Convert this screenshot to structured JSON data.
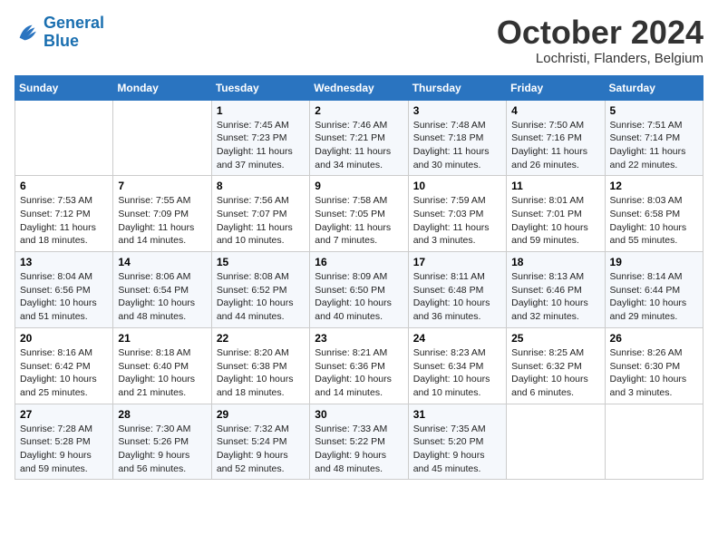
{
  "logo": {
    "line1": "General",
    "line2": "Blue"
  },
  "title": "October 2024",
  "location": "Lochristi, Flanders, Belgium",
  "days_of_week": [
    "Sunday",
    "Monday",
    "Tuesday",
    "Wednesday",
    "Thursday",
    "Friday",
    "Saturday"
  ],
  "weeks": [
    [
      {
        "day": "",
        "content": ""
      },
      {
        "day": "",
        "content": ""
      },
      {
        "day": "1",
        "content": "Sunrise: 7:45 AM\nSunset: 7:23 PM\nDaylight: 11 hours\nand 37 minutes."
      },
      {
        "day": "2",
        "content": "Sunrise: 7:46 AM\nSunset: 7:21 PM\nDaylight: 11 hours\nand 34 minutes."
      },
      {
        "day": "3",
        "content": "Sunrise: 7:48 AM\nSunset: 7:18 PM\nDaylight: 11 hours\nand 30 minutes."
      },
      {
        "day": "4",
        "content": "Sunrise: 7:50 AM\nSunset: 7:16 PM\nDaylight: 11 hours\nand 26 minutes."
      },
      {
        "day": "5",
        "content": "Sunrise: 7:51 AM\nSunset: 7:14 PM\nDaylight: 11 hours\nand 22 minutes."
      }
    ],
    [
      {
        "day": "6",
        "content": "Sunrise: 7:53 AM\nSunset: 7:12 PM\nDaylight: 11 hours\nand 18 minutes."
      },
      {
        "day": "7",
        "content": "Sunrise: 7:55 AM\nSunset: 7:09 PM\nDaylight: 11 hours\nand 14 minutes."
      },
      {
        "day": "8",
        "content": "Sunrise: 7:56 AM\nSunset: 7:07 PM\nDaylight: 11 hours\nand 10 minutes."
      },
      {
        "day": "9",
        "content": "Sunrise: 7:58 AM\nSunset: 7:05 PM\nDaylight: 11 hours\nand 7 minutes."
      },
      {
        "day": "10",
        "content": "Sunrise: 7:59 AM\nSunset: 7:03 PM\nDaylight: 11 hours\nand 3 minutes."
      },
      {
        "day": "11",
        "content": "Sunrise: 8:01 AM\nSunset: 7:01 PM\nDaylight: 10 hours\nand 59 minutes."
      },
      {
        "day": "12",
        "content": "Sunrise: 8:03 AM\nSunset: 6:58 PM\nDaylight: 10 hours\nand 55 minutes."
      }
    ],
    [
      {
        "day": "13",
        "content": "Sunrise: 8:04 AM\nSunset: 6:56 PM\nDaylight: 10 hours\nand 51 minutes."
      },
      {
        "day": "14",
        "content": "Sunrise: 8:06 AM\nSunset: 6:54 PM\nDaylight: 10 hours\nand 48 minutes."
      },
      {
        "day": "15",
        "content": "Sunrise: 8:08 AM\nSunset: 6:52 PM\nDaylight: 10 hours\nand 44 minutes."
      },
      {
        "day": "16",
        "content": "Sunrise: 8:09 AM\nSunset: 6:50 PM\nDaylight: 10 hours\nand 40 minutes."
      },
      {
        "day": "17",
        "content": "Sunrise: 8:11 AM\nSunset: 6:48 PM\nDaylight: 10 hours\nand 36 minutes."
      },
      {
        "day": "18",
        "content": "Sunrise: 8:13 AM\nSunset: 6:46 PM\nDaylight: 10 hours\nand 32 minutes."
      },
      {
        "day": "19",
        "content": "Sunrise: 8:14 AM\nSunset: 6:44 PM\nDaylight: 10 hours\nand 29 minutes."
      }
    ],
    [
      {
        "day": "20",
        "content": "Sunrise: 8:16 AM\nSunset: 6:42 PM\nDaylight: 10 hours\nand 25 minutes."
      },
      {
        "day": "21",
        "content": "Sunrise: 8:18 AM\nSunset: 6:40 PM\nDaylight: 10 hours\nand 21 minutes."
      },
      {
        "day": "22",
        "content": "Sunrise: 8:20 AM\nSunset: 6:38 PM\nDaylight: 10 hours\nand 18 minutes."
      },
      {
        "day": "23",
        "content": "Sunrise: 8:21 AM\nSunset: 6:36 PM\nDaylight: 10 hours\nand 14 minutes."
      },
      {
        "day": "24",
        "content": "Sunrise: 8:23 AM\nSunset: 6:34 PM\nDaylight: 10 hours\nand 10 minutes."
      },
      {
        "day": "25",
        "content": "Sunrise: 8:25 AM\nSunset: 6:32 PM\nDaylight: 10 hours\nand 6 minutes."
      },
      {
        "day": "26",
        "content": "Sunrise: 8:26 AM\nSunset: 6:30 PM\nDaylight: 10 hours\nand 3 minutes."
      }
    ],
    [
      {
        "day": "27",
        "content": "Sunrise: 7:28 AM\nSunset: 5:28 PM\nDaylight: 9 hours\nand 59 minutes."
      },
      {
        "day": "28",
        "content": "Sunrise: 7:30 AM\nSunset: 5:26 PM\nDaylight: 9 hours\nand 56 minutes."
      },
      {
        "day": "29",
        "content": "Sunrise: 7:32 AM\nSunset: 5:24 PM\nDaylight: 9 hours\nand 52 minutes."
      },
      {
        "day": "30",
        "content": "Sunrise: 7:33 AM\nSunset: 5:22 PM\nDaylight: 9 hours\nand 48 minutes."
      },
      {
        "day": "31",
        "content": "Sunrise: 7:35 AM\nSunset: 5:20 PM\nDaylight: 9 hours\nand 45 minutes."
      },
      {
        "day": "",
        "content": ""
      },
      {
        "day": "",
        "content": ""
      }
    ]
  ]
}
